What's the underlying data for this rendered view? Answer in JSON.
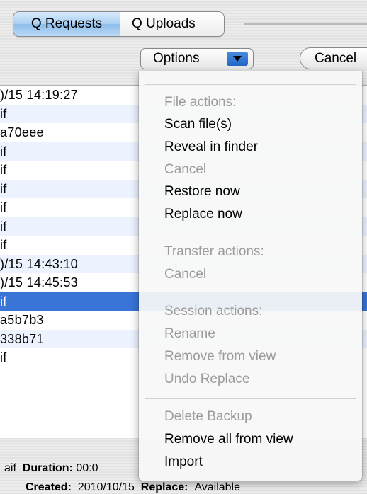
{
  "tabs": [
    {
      "label": "Q Requests",
      "active": true
    },
    {
      "label": "Q Uploads",
      "active": false
    }
  ],
  "toolbar": {
    "options_label": "Options",
    "cancel_label": "Cancel"
  },
  "table": {
    "rows": [
      {
        "text": ")/15 14:19:27",
        "style": "plain"
      },
      {
        "text": "if",
        "style": "alt"
      },
      {
        "text": "a70eee",
        "style": "plain"
      },
      {
        "text": "if",
        "style": "alt"
      },
      {
        "text": "if",
        "style": "plain"
      },
      {
        "text": "if",
        "style": "alt"
      },
      {
        "text": "if",
        "style": "plain"
      },
      {
        "text": "if",
        "style": "alt"
      },
      {
        "text": "if",
        "style": "plain"
      },
      {
        "text": ")/15 14:43:10",
        "style": "alt"
      },
      {
        "text": ")/15 14:45:53",
        "style": "plain"
      },
      {
        "text": "if",
        "style": "selected"
      },
      {
        "text": "a5b7b3",
        "style": "plain"
      },
      {
        "text": "338b71",
        "style": "alt"
      },
      {
        "text": "if",
        "style": "plain"
      }
    ]
  },
  "details": {
    "line1_prefix": "aif",
    "duration_label": "Duration:",
    "duration_value": "00:0",
    "line2_created_label": "Created:",
    "line2_created_value": "2010/10/15",
    "line2_replace_label": "Replace:",
    "line2_replace_value": "Available"
  },
  "menu": {
    "file_header": "File actions:",
    "scan": "Scan file(s)",
    "reveal": "Reveal in finder",
    "file_cancel": "Cancel",
    "restore": "Restore now",
    "replace": "Replace now",
    "transfer_header": "Transfer actions:",
    "transfer_cancel": "Cancel",
    "session_header": "Session actions:",
    "rename": "Rename",
    "remove_view": "Remove from view",
    "undo_replace": "Undo Replace",
    "delete_backup": "Delete Backup",
    "remove_all": "Remove all from view",
    "import": "Import"
  },
  "colors": {
    "selection": "#3875d7",
    "active_tab": "#a9cff2",
    "disabled_text": "#9b9b9b"
  }
}
